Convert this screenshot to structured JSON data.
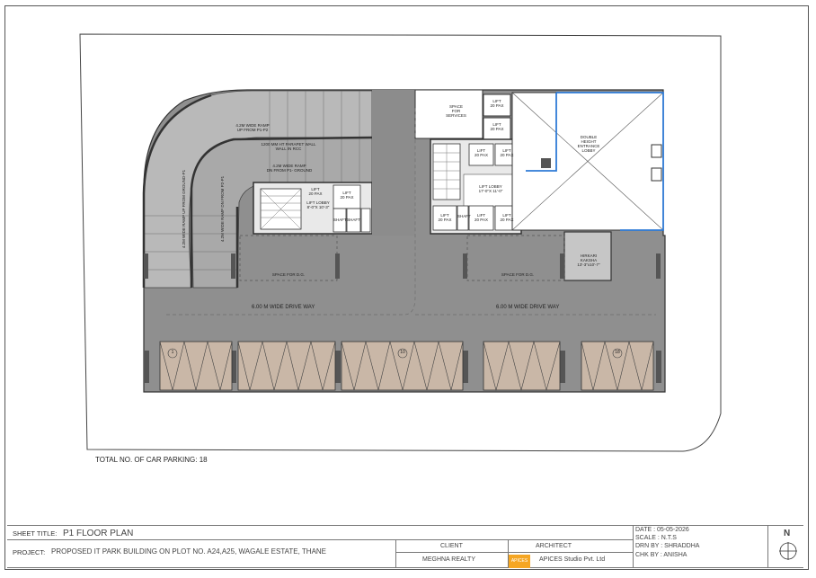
{
  "plan": {
    "ramp_top_label": "4.2M WIDE RAMP\nUP FROM P1-P2",
    "parapet_label": "1200 MM HT PARAPET WALL\nWALL IN RCC",
    "ramp_middle_label": "4.2M WIDE RAMP\nDN FROM P1- GROUND",
    "ramp_left_outer_label": "4.2M WIDE RAMP UP FROM GROUND-P1",
    "ramp_left_inner_label": "4.2M WIDE RAMP DN FROM P2-P1",
    "space_for_services": "SPACE\nFOR\nSERVICES",
    "double_height_lobby": "DOUBLE\nHEIGHT\nENTRANCE\nLOBBY",
    "hirkari_kaksha": "HIRKARI\nKAKSHA\n13'-3\"x10'-7\"",
    "space_for_dg_left": "SPACE FOR D.G.",
    "space_for_dg_right": "SPACE FOR D.G.",
    "drive_way_left": "6.00 M WIDE DRIVE WAY",
    "drive_way_right": "6.00 M WIDE DRIVE WAY",
    "lift_lobby_left": "LIFT LOBBY\n8'-0\"X 10'-3\"",
    "lift_lobby_right": "LIFT LOBBY\n17'-0\"X 11'-0\"",
    "lift_labels": [
      "LIFT\n20 PAX",
      "LIFT\n20 PAX",
      "LIFT\n20 PAX",
      "LIFT\n20 PAX",
      "LIFT\n20 PAX",
      "LIFT\n20 PAX",
      "LIFT\n20 PAX",
      "LIFT\n20 PAX",
      "LIFT\n20 PAX"
    ],
    "shaft_labels": [
      "SHAFT",
      "SHAFT",
      "SHAFT"
    ],
    "parking_numbers": [
      "1",
      "10",
      "18"
    ]
  },
  "notes": {
    "total_parking": "TOTAL NO. OF CAR PARKING: 18"
  },
  "title_block": {
    "sheet_title_key": "SHEET TITLE:",
    "sheet_title": "P1 FLOOR  PLAN",
    "project_key": "PROJECT:",
    "project": "PROPOSED IT PARK BUILDING ON PLOT NO. A24,A25, WAGALE ESTATE, THANE",
    "client_header": "CLIENT",
    "client": "MEGHNA REALTY",
    "architect_header": "ARCHITECT",
    "architect": "APICES Studio Pvt. Ltd",
    "logo_text": "APICES",
    "date": "DATE :    05-05-2026",
    "scale": "SCALE :   N.T.S",
    "drawn_by": "DRN BY : SHRADDHA",
    "checked_by": "CHK BY : ANISHA",
    "north": "N"
  },
  "colors": {
    "concrete": "#8f8f8f",
    "drive": "#8c8c8c",
    "parking_bay": "#c9b7a7",
    "wall": "#3a3a3a",
    "lobby_outline": "#2f7bd6",
    "logo": "#f5a623"
  }
}
